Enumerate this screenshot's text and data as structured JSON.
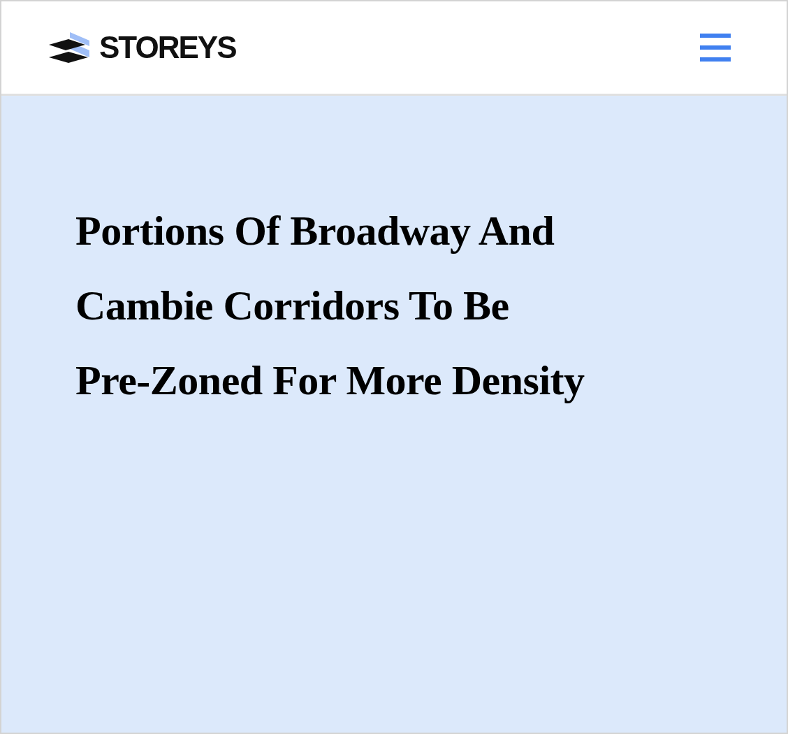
{
  "header": {
    "logo_text": "STOREYS"
  },
  "hero": {
    "headline": "Portions Of Broadway And Cambie Corridors To Be Pre-Zoned For More Density"
  }
}
